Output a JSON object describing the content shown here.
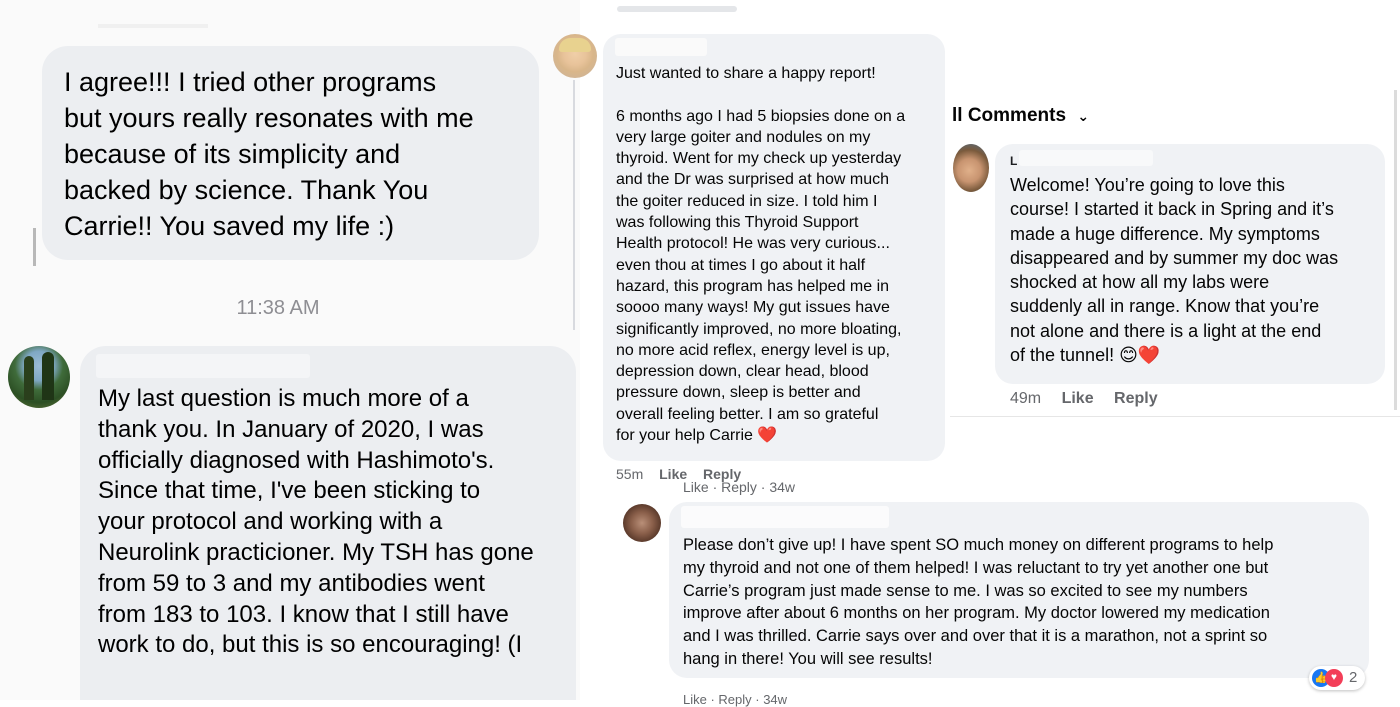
{
  "panel1": {
    "message1": "I agree!!! I tried other programs\nbut yours really resonates with me\nbecause of its simplicity and\nbacked by science. Thank You\nCarrie!! You saved my life :)",
    "timestamp": "11:38 AM",
    "message2": "My last question is much more of a\nthank you. In January of 2020, I was\nofficially diagnosed with Hashimoto's.\nSince that time, I've been sticking to\nyour protocol and working with a\nNeurolink practicioner. My TSH has gone\nfrom 59 to 3 and my antibodies went\nfrom 183 to 103. I know that I still have\nwork to do, but this is so encouraging! (I"
  },
  "panel2": {
    "comment": "Just wanted to share a happy report!\n\n6 months ago I had 5 biopsies done on a\nvery large goiter and nodules on my\nthyroid. Went for my check up yesterday\nand the Dr was surprised at how much\nthe goiter reduced in size. I told him I\nwas following this Thyroid Support\nHealth protocol! He was very curious...\neven thou at times I go about it half\nhazard, this program has helped me in\nsoooo many ways! My gut issues have\nsignificantly improved, no more bloating,\nno more acid reflex, energy level is up,\ndepression down, clear head, blood\npressure down, sleep is better and\noverall feeling better. I am so grateful\nfor your help Carrie",
    "emoji": "❤️",
    "time": "55m",
    "like": "Like",
    "reply": "Reply"
  },
  "panel3": {
    "header": "ll Comments",
    "author_initial": "L",
    "comment": "Welcome! You’re going to love this\ncourse! I started it back in Spring and it’s\nmade a huge difference. My symptoms\ndisappeared and by summer my doc was\nshocked at how all my labs were\nsuddenly all in range. Know that you’re\nnot alone and there is a light at the end\nof the tunnel!",
    "emoji": "😊❤️",
    "time": "49m",
    "like": "Like",
    "reply": "Reply"
  },
  "panel4": {
    "top_meta": "Like · Reply · 34w",
    "comment": "Please don’t give up! I have spent SO much money on different programs to help\nmy thyroid and not one of them helped! I was reluctant to try yet another one but\nCarrie’s program just made sense to me. I was so excited to see my numbers\nimprove after about 6 months on her program. My doctor lowered my medication\nand I was thrilled. Carrie says over and over that it is a marathon, not a sprint so\nhang in there! You will see results!",
    "reaction_count": "2",
    "bottom_meta": "Like · Reply · 34w"
  }
}
